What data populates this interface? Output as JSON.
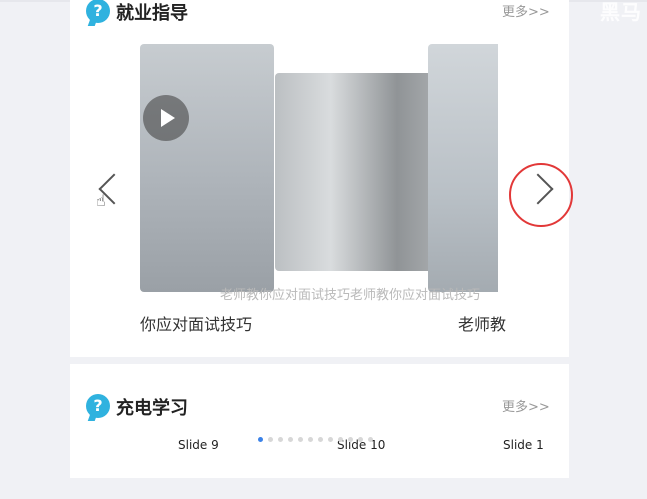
{
  "corner_text": "黑马",
  "section1": {
    "title": "就业指导",
    "more": "更多>>",
    "overlay_caption": "老师教你应对面试技巧老师教你应对面试技巧",
    "captions": [
      "你应对面试技巧",
      "老师教"
    ]
  },
  "section2": {
    "title": "充电学习",
    "more": "更多>>",
    "slides": [
      "Slide 9",
      "Slide 10",
      "Slide 1"
    ],
    "pagination": {
      "total": 12,
      "active_index": 0
    }
  },
  "icons": {
    "question": "question-icon",
    "play": "play-icon",
    "prev": "chevron-left-icon",
    "next": "chevron-right-icon",
    "cursor": "hand-pointer-icon"
  },
  "colors": {
    "accent": "#2fb2df",
    "highlight_ring": "#e23838",
    "pagination_active": "#3b82e8"
  }
}
